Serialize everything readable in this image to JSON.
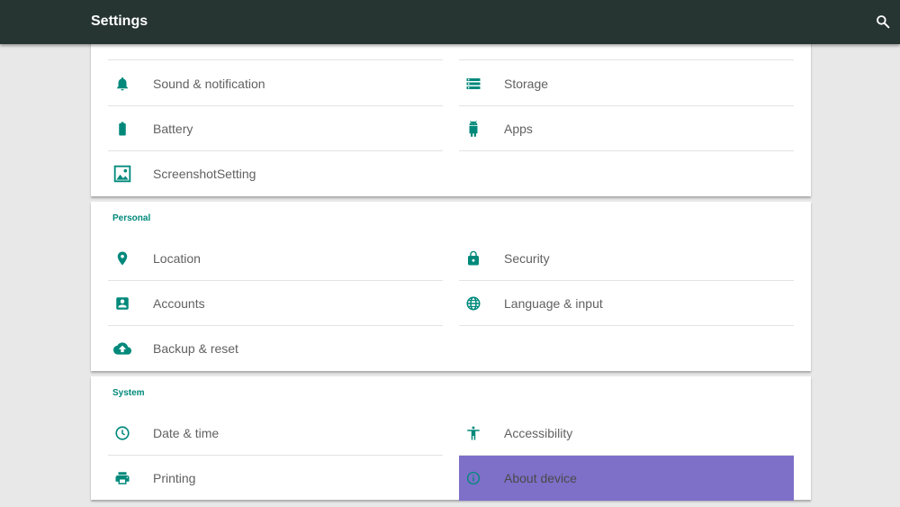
{
  "appbar": {
    "title": "Settings",
    "search_icon": "search-icon"
  },
  "colors": {
    "appbar": "#263432",
    "accent": "#00897b",
    "selected": "#7e6fc8",
    "background": "#e8e8e8"
  },
  "device": {
    "items": [
      {
        "label": "Sound & notification",
        "icon": "bell-icon"
      },
      {
        "label": "Storage",
        "icon": "storage-icon"
      },
      {
        "label": "Battery",
        "icon": "battery-icon"
      },
      {
        "label": "Apps",
        "icon": "android-icon"
      },
      {
        "label": "ScreenshotSetting",
        "icon": "image-icon"
      }
    ]
  },
  "personal": {
    "header": "Personal",
    "items": [
      {
        "label": "Location",
        "icon": "location-pin-icon"
      },
      {
        "label": "Security",
        "icon": "lock-icon"
      },
      {
        "label": "Accounts",
        "icon": "account-box-icon"
      },
      {
        "label": "Language & input",
        "icon": "globe-icon"
      },
      {
        "label": "Backup & reset",
        "icon": "cloud-upload-icon"
      }
    ]
  },
  "system": {
    "header": "System",
    "items": [
      {
        "label": "Date & time",
        "icon": "clock-icon"
      },
      {
        "label": "Accessibility",
        "icon": "accessibility-icon"
      },
      {
        "label": "Printing",
        "icon": "printer-icon"
      },
      {
        "label": "About device",
        "icon": "info-icon",
        "selected": true
      }
    ]
  }
}
